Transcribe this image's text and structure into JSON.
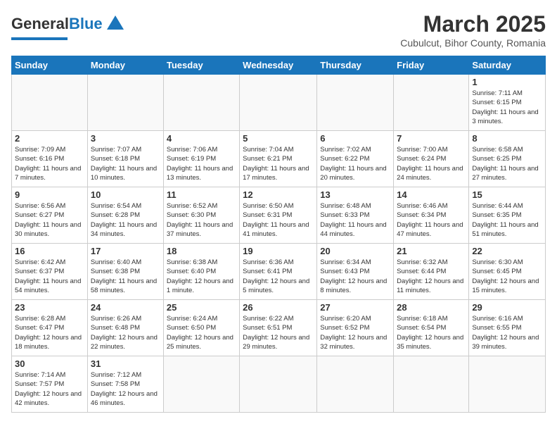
{
  "header": {
    "logo_general": "General",
    "logo_blue": "Blue",
    "month_year": "March 2025",
    "location": "Cubulcut, Bihor County, Romania"
  },
  "weekdays": [
    "Sunday",
    "Monday",
    "Tuesday",
    "Wednesday",
    "Thursday",
    "Friday",
    "Saturday"
  ],
  "weeks": [
    [
      {
        "day": "",
        "info": ""
      },
      {
        "day": "",
        "info": ""
      },
      {
        "day": "",
        "info": ""
      },
      {
        "day": "",
        "info": ""
      },
      {
        "day": "",
        "info": ""
      },
      {
        "day": "",
        "info": ""
      },
      {
        "day": "1",
        "info": "Sunrise: 7:11 AM\nSunset: 6:15 PM\nDaylight: 11 hours and 3 minutes."
      }
    ],
    [
      {
        "day": "2",
        "info": "Sunrise: 7:09 AM\nSunset: 6:16 PM\nDaylight: 11 hours and 7 minutes."
      },
      {
        "day": "3",
        "info": "Sunrise: 7:07 AM\nSunset: 6:18 PM\nDaylight: 11 hours and 10 minutes."
      },
      {
        "day": "4",
        "info": "Sunrise: 7:06 AM\nSunset: 6:19 PM\nDaylight: 11 hours and 13 minutes."
      },
      {
        "day": "5",
        "info": "Sunrise: 7:04 AM\nSunset: 6:21 PM\nDaylight: 11 hours and 17 minutes."
      },
      {
        "day": "6",
        "info": "Sunrise: 7:02 AM\nSunset: 6:22 PM\nDaylight: 11 hours and 20 minutes."
      },
      {
        "day": "7",
        "info": "Sunrise: 7:00 AM\nSunset: 6:24 PM\nDaylight: 11 hours and 24 minutes."
      },
      {
        "day": "8",
        "info": "Sunrise: 6:58 AM\nSunset: 6:25 PM\nDaylight: 11 hours and 27 minutes."
      }
    ],
    [
      {
        "day": "9",
        "info": "Sunrise: 6:56 AM\nSunset: 6:27 PM\nDaylight: 11 hours and 30 minutes."
      },
      {
        "day": "10",
        "info": "Sunrise: 6:54 AM\nSunset: 6:28 PM\nDaylight: 11 hours and 34 minutes."
      },
      {
        "day": "11",
        "info": "Sunrise: 6:52 AM\nSunset: 6:30 PM\nDaylight: 11 hours and 37 minutes."
      },
      {
        "day": "12",
        "info": "Sunrise: 6:50 AM\nSunset: 6:31 PM\nDaylight: 11 hours and 41 minutes."
      },
      {
        "day": "13",
        "info": "Sunrise: 6:48 AM\nSunset: 6:33 PM\nDaylight: 11 hours and 44 minutes."
      },
      {
        "day": "14",
        "info": "Sunrise: 6:46 AM\nSunset: 6:34 PM\nDaylight: 11 hours and 47 minutes."
      },
      {
        "day": "15",
        "info": "Sunrise: 6:44 AM\nSunset: 6:35 PM\nDaylight: 11 hours and 51 minutes."
      }
    ],
    [
      {
        "day": "16",
        "info": "Sunrise: 6:42 AM\nSunset: 6:37 PM\nDaylight: 11 hours and 54 minutes."
      },
      {
        "day": "17",
        "info": "Sunrise: 6:40 AM\nSunset: 6:38 PM\nDaylight: 11 hours and 58 minutes."
      },
      {
        "day": "18",
        "info": "Sunrise: 6:38 AM\nSunset: 6:40 PM\nDaylight: 12 hours and 1 minute."
      },
      {
        "day": "19",
        "info": "Sunrise: 6:36 AM\nSunset: 6:41 PM\nDaylight: 12 hours and 5 minutes."
      },
      {
        "day": "20",
        "info": "Sunrise: 6:34 AM\nSunset: 6:43 PM\nDaylight: 12 hours and 8 minutes."
      },
      {
        "day": "21",
        "info": "Sunrise: 6:32 AM\nSunset: 6:44 PM\nDaylight: 12 hours and 11 minutes."
      },
      {
        "day": "22",
        "info": "Sunrise: 6:30 AM\nSunset: 6:45 PM\nDaylight: 12 hours and 15 minutes."
      }
    ],
    [
      {
        "day": "23",
        "info": "Sunrise: 6:28 AM\nSunset: 6:47 PM\nDaylight: 12 hours and 18 minutes."
      },
      {
        "day": "24",
        "info": "Sunrise: 6:26 AM\nSunset: 6:48 PM\nDaylight: 12 hours and 22 minutes."
      },
      {
        "day": "25",
        "info": "Sunrise: 6:24 AM\nSunset: 6:50 PM\nDaylight: 12 hours and 25 minutes."
      },
      {
        "day": "26",
        "info": "Sunrise: 6:22 AM\nSunset: 6:51 PM\nDaylight: 12 hours and 29 minutes."
      },
      {
        "day": "27",
        "info": "Sunrise: 6:20 AM\nSunset: 6:52 PM\nDaylight: 12 hours and 32 minutes."
      },
      {
        "day": "28",
        "info": "Sunrise: 6:18 AM\nSunset: 6:54 PM\nDaylight: 12 hours and 35 minutes."
      },
      {
        "day": "29",
        "info": "Sunrise: 6:16 AM\nSunset: 6:55 PM\nDaylight: 12 hours and 39 minutes."
      }
    ],
    [
      {
        "day": "30",
        "info": "Sunrise: 7:14 AM\nSunset: 7:57 PM\nDaylight: 12 hours and 42 minutes."
      },
      {
        "day": "31",
        "info": "Sunrise: 7:12 AM\nSunset: 7:58 PM\nDaylight: 12 hours and 46 minutes."
      },
      {
        "day": "",
        "info": ""
      },
      {
        "day": "",
        "info": ""
      },
      {
        "day": "",
        "info": ""
      },
      {
        "day": "",
        "info": ""
      },
      {
        "day": "",
        "info": ""
      }
    ]
  ]
}
